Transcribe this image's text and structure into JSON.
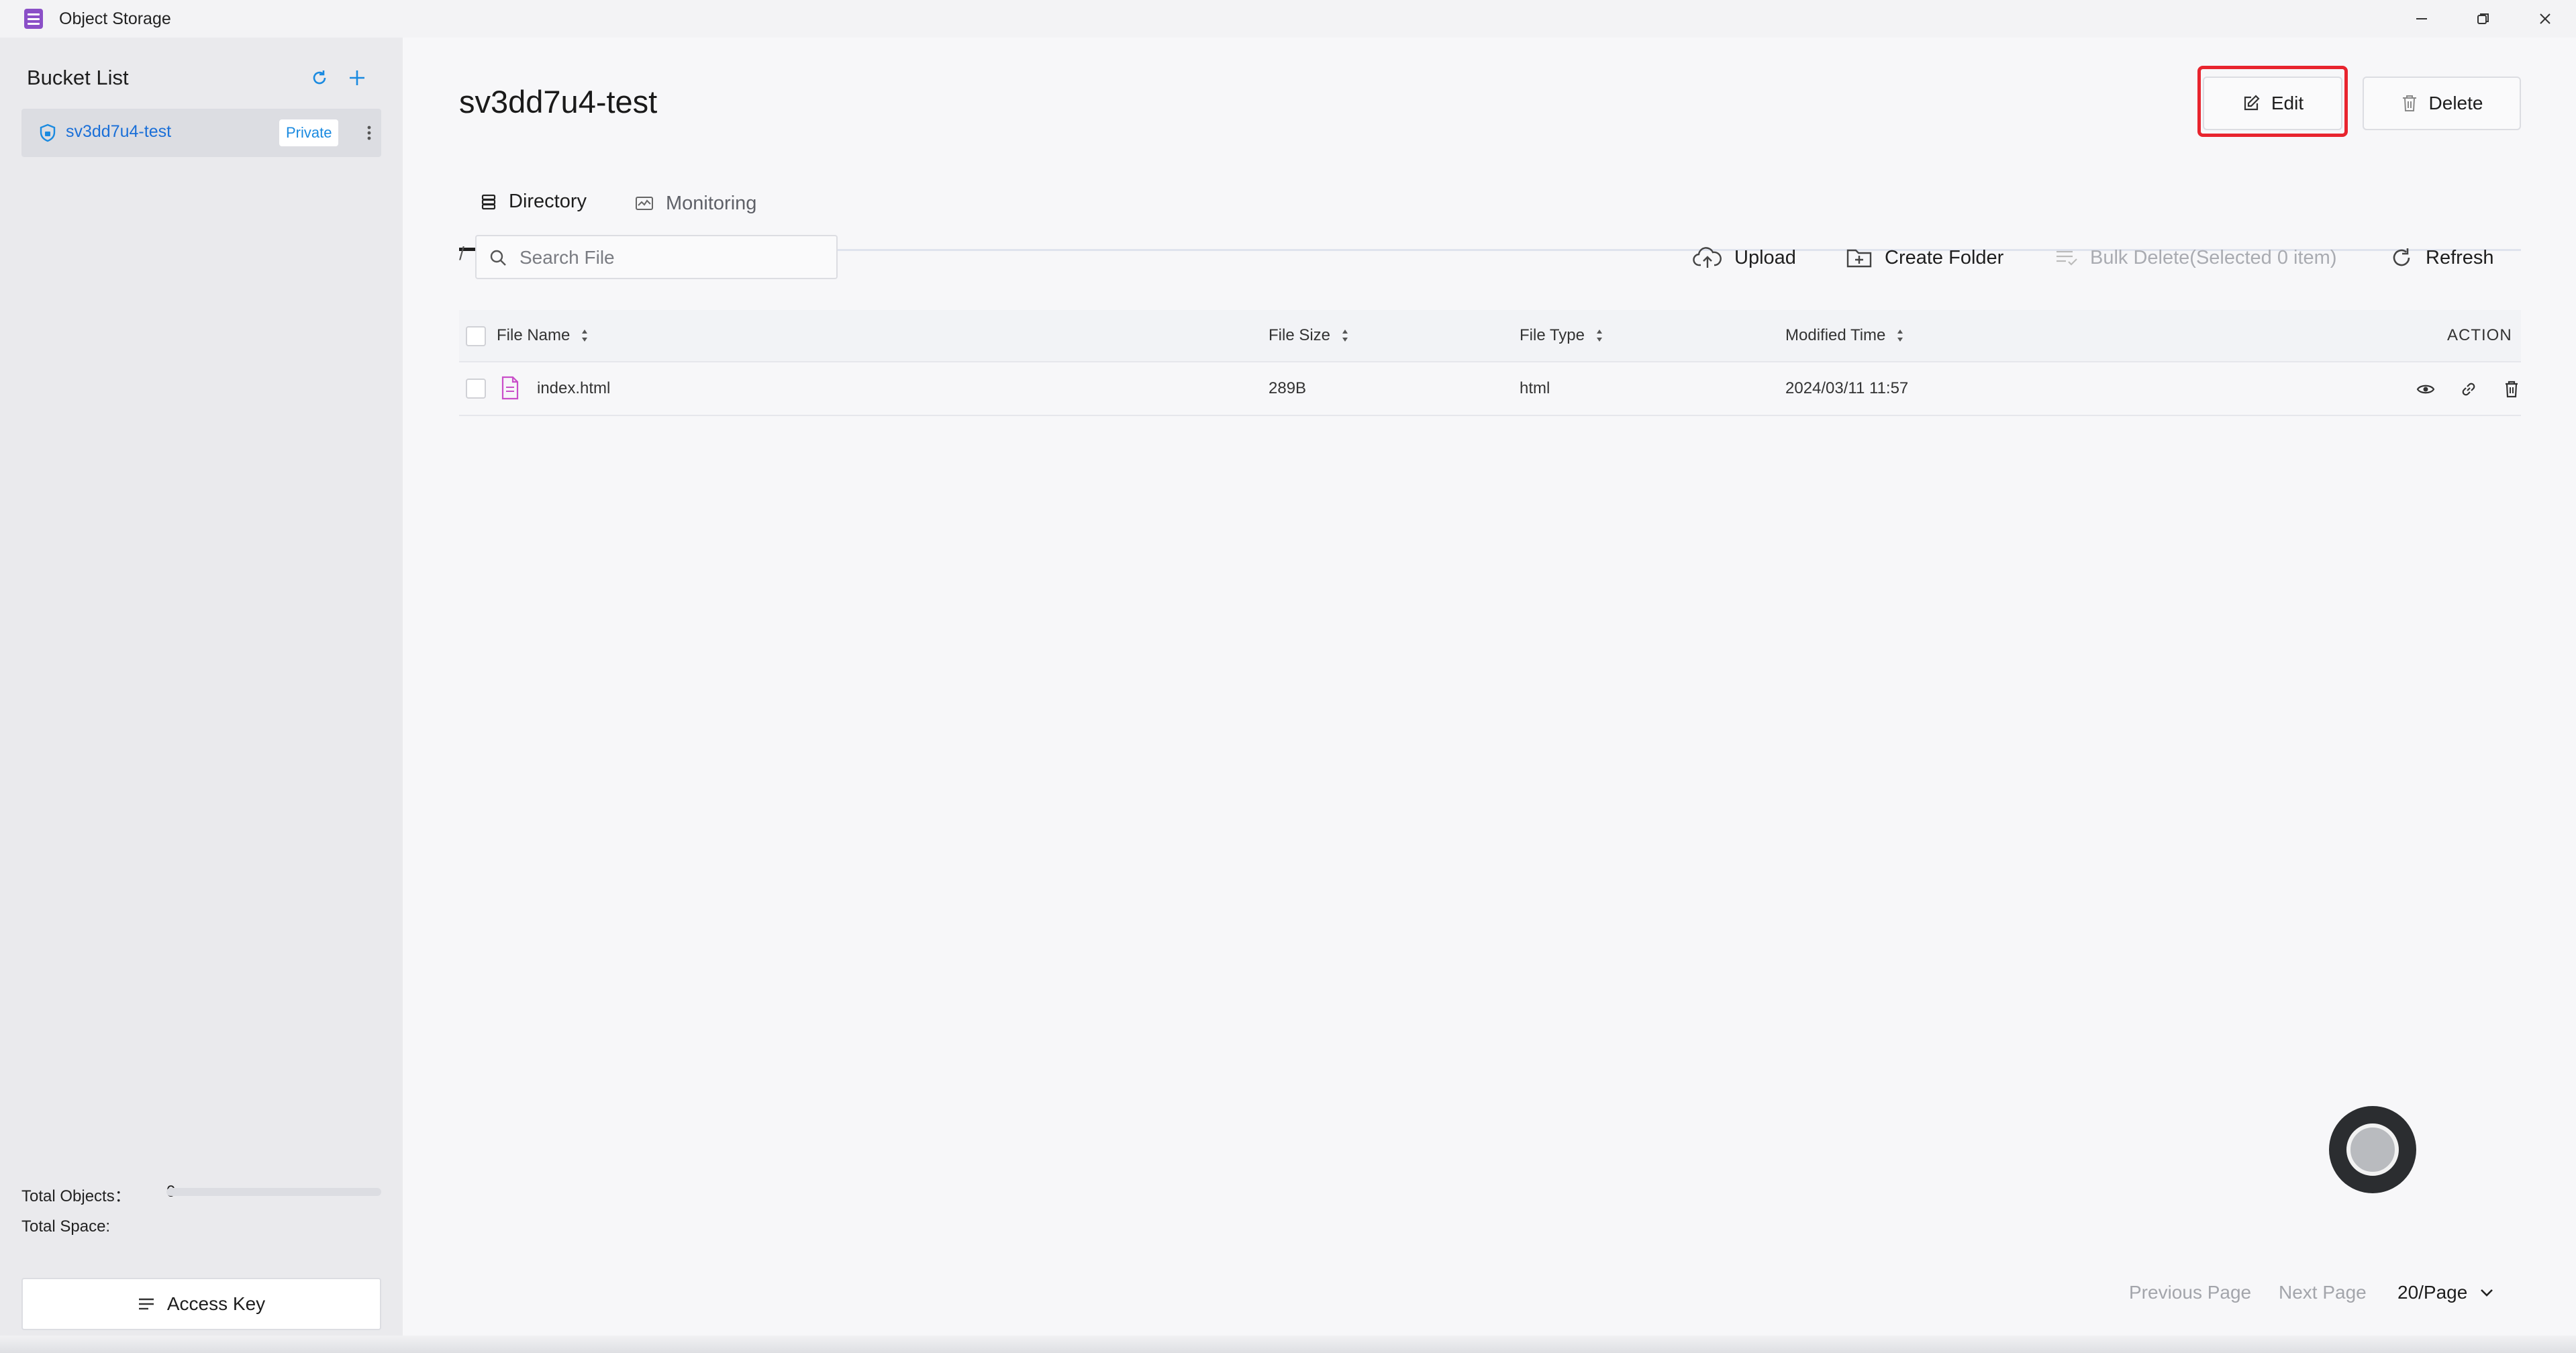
{
  "window": {
    "title": "Object Storage",
    "controls": [
      "minimize-icon",
      "restore-icon",
      "close-icon"
    ]
  },
  "sidebar": {
    "title": "Bucket List",
    "buckets": [
      {
        "name": "sv3dd7u4-test",
        "badge": "Private",
        "selected": true
      }
    ],
    "stats": {
      "objects_label": "Total Objects：",
      "objects_value": "0",
      "space_label": "Total Space:",
      "space_used_fraction": 0
    },
    "access_key_label": "Access Key"
  },
  "main": {
    "bucket_title": "sv3dd7u4-test",
    "edit_label": "Edit",
    "delete_label": "Delete",
    "tabs": [
      {
        "label": "Directory",
        "active": true
      },
      {
        "label": "Monitoring",
        "active": false
      }
    ],
    "path": "/",
    "search_placeholder": "Search File",
    "toolbar": {
      "upload": "Upload",
      "create_folder": "Create Folder",
      "bulk_delete": "Bulk Delete(Selected 0 item)",
      "refresh": "Refresh"
    },
    "table": {
      "columns": [
        "File Name",
        "File Size",
        "File Type",
        "Modified Time",
        "ACTION"
      ],
      "rows": [
        {
          "name": "index.html",
          "size": "289B",
          "type": "html",
          "modified": "2024/03/11 11:57"
        }
      ]
    },
    "pagination": {
      "prev": "Previous Page",
      "next": "Next Page",
      "page_size": "20/Page"
    }
  },
  "colors": {
    "accent": "#1a6fd8",
    "highlight": "#e8242e",
    "app_logo": "#8a4fc7",
    "file_icon": "#c94fc9"
  }
}
